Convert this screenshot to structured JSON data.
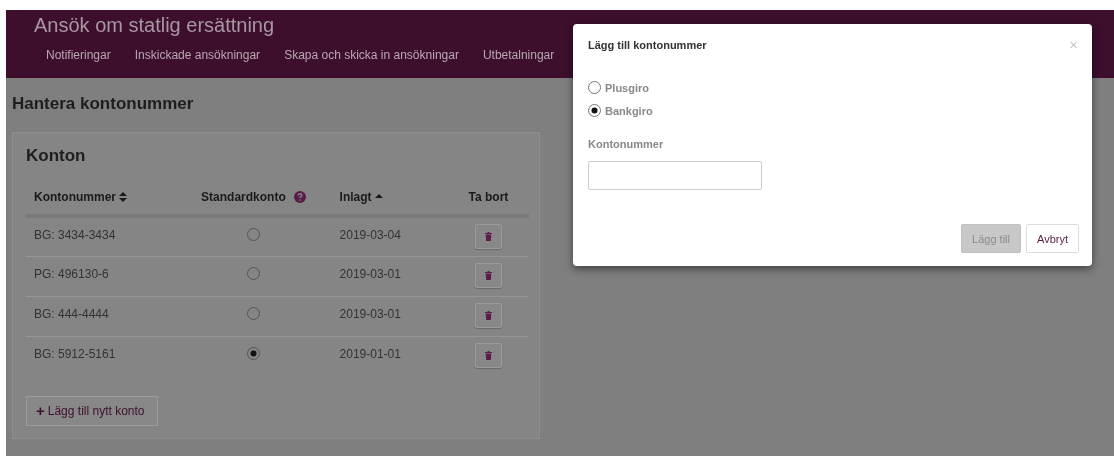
{
  "header": {
    "title": "Ansök om statlig ersättning",
    "nav": [
      {
        "label": "Notifieringar"
      },
      {
        "label": "Inskickade ansökningar"
      },
      {
        "label": "Skapa och skicka in ansökningar"
      },
      {
        "label": "Utbetalningar"
      }
    ]
  },
  "page": {
    "heading": "Hantera kontonummer"
  },
  "card": {
    "title": "Konton",
    "table": {
      "columns": [
        {
          "label": "Kontonummer",
          "kind": "sortable",
          "help": false
        },
        {
          "label": "Standardkonto",
          "kind": "plain",
          "help": true
        },
        {
          "label": "Inlagt",
          "kind": "sorted",
          "help": false
        },
        {
          "label": "Ta bort",
          "kind": "plain",
          "help": false
        }
      ],
      "rows": [
        {
          "account": "BG: 3434-3434",
          "selected": false,
          "date": "2019-03-04"
        },
        {
          "account": "PG: 496130-6",
          "selected": false,
          "date": "2019-03-01"
        },
        {
          "account": "BG: 444-4444",
          "selected": false,
          "date": "2019-03-01"
        },
        {
          "account": "BG: 5912-5161",
          "selected": true,
          "date": "2019-01-01"
        }
      ]
    },
    "add_button": {
      "icon": "+",
      "label": "Lägg till nytt konto"
    }
  },
  "dialog": {
    "title": "Lägg till kontonummer",
    "close": "×",
    "options": [
      {
        "label": "Plusgiro",
        "selected": false
      },
      {
        "label": "Bankgiro",
        "selected": true
      }
    ],
    "field_label": "Kontonummer",
    "buttons": [
      {
        "label": "Lägg till",
        "disabled": true
      },
      {
        "label": "Avbryt",
        "disabled": false
      }
    ]
  }
}
